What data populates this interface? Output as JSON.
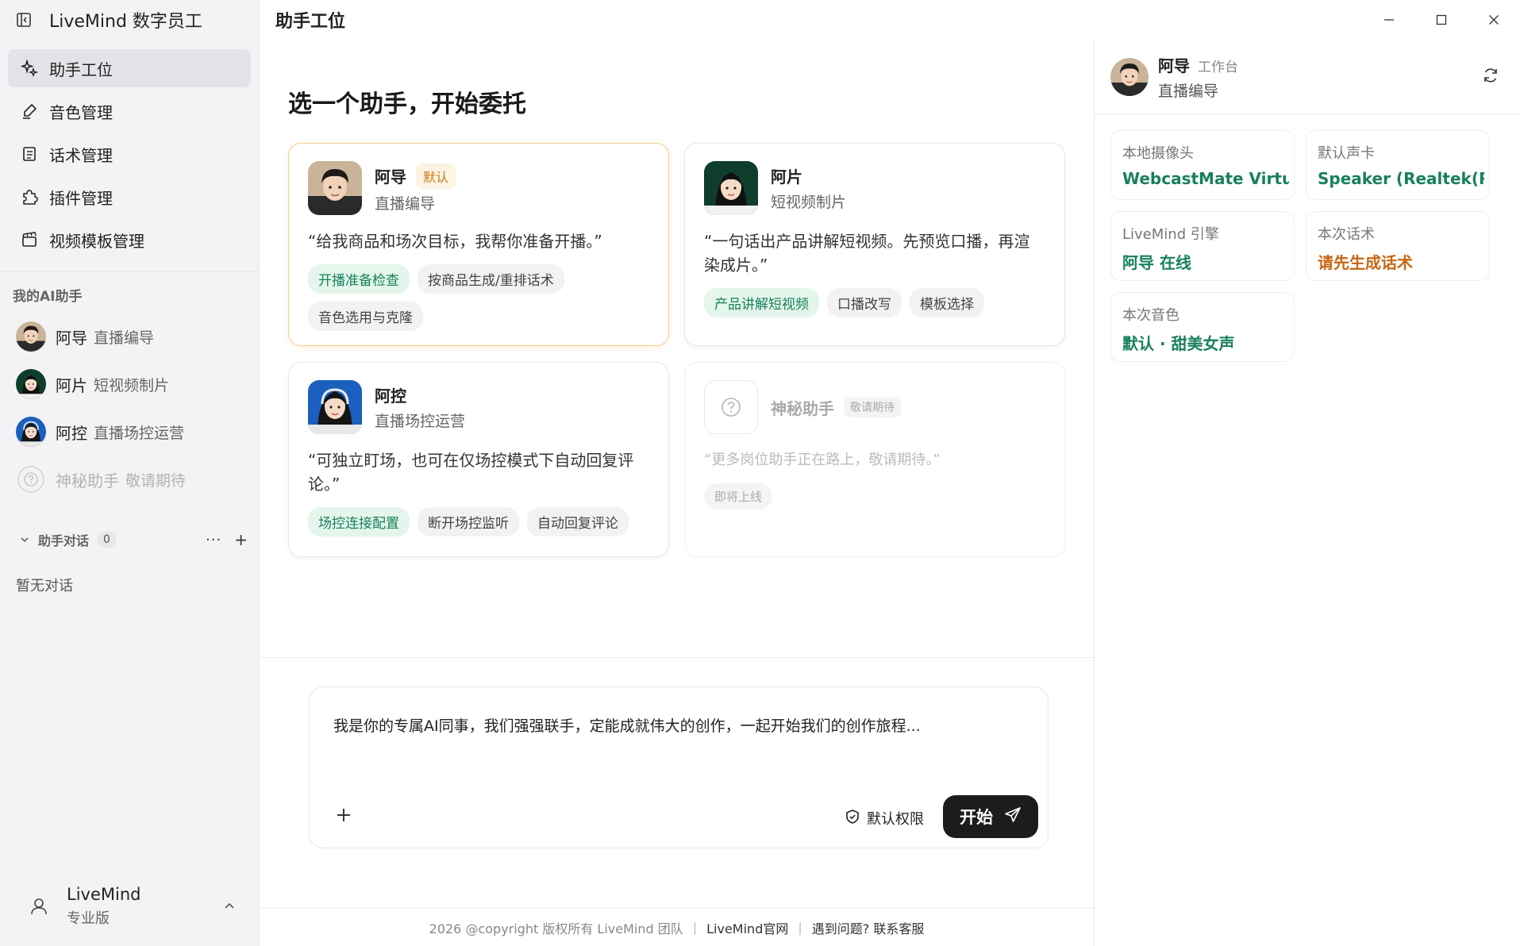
{
  "app": {
    "title": "LiveMind 数字员工"
  },
  "page": {
    "title": "助手工位",
    "heading": "选一个助手，开始委托"
  },
  "nav": [
    {
      "label": "助手工位",
      "icon": "sparkle-icon",
      "active": true
    },
    {
      "label": "音色管理",
      "icon": "brush-icon"
    },
    {
      "label": "话术管理",
      "icon": "script-icon"
    },
    {
      "label": "插件管理",
      "icon": "puzzle-icon"
    },
    {
      "label": "视频模板管理",
      "icon": "clapper-icon"
    }
  ],
  "sidebar": {
    "agents_title": "我的AI助手",
    "agents": [
      {
        "name": "阿导",
        "role": "直播编导"
      },
      {
        "name": "阿片",
        "role": "短视频制片"
      },
      {
        "name": "阿控",
        "role": "直播场控运营"
      },
      {
        "name": "神秘助手",
        "role": "敬请期待"
      }
    ],
    "conv_title": "助手对话",
    "conv_count": "0",
    "conv_more": "···",
    "conv_add": "+",
    "conv_empty": "暂无对话",
    "user_name": "LiveMind",
    "user_plan": "专业版"
  },
  "cards": [
    {
      "name": "阿导",
      "badge": "默认",
      "role": "直播编导",
      "quote": "“给我商品和场次目标，我帮你准备开播。”",
      "tags": [
        "开播准备检查",
        "按商品生成/重排话术",
        "音色选用与克隆"
      ]
    },
    {
      "name": "阿片",
      "role": "短视频制片",
      "quote": "“一句话出产品讲解短视频。先预览口播，再渲染成片。”",
      "tags": [
        "产品讲解短视频",
        "口播改写",
        "模板选择"
      ]
    },
    {
      "name": "阿控",
      "role": "直播场控运营",
      "quote": "“可独立盯场，也可在仅场控模式下自动回复评论。”",
      "tags": [
        "场控连接配置",
        "断开场控监听",
        "自动回复评论"
      ]
    },
    {
      "name": "神秘助手",
      "badge": "敬请期待",
      "quote": "“更多岗位助手正在路上，敬请期待。”",
      "tags": [
        "即将上线"
      ]
    }
  ],
  "composer": {
    "text": "我是你的专属AI同事，我们强强联手，定能成就伟大的创作，一起开始我们的创作旅程...",
    "permission": "默认权限",
    "start": "开始",
    "add": "+"
  },
  "footer": {
    "copyright": "2026 @copyright 版权所有 LiveMind 团队",
    "site": "LiveMind官网",
    "help": "遇到问题? 联系客服",
    "sep": "|"
  },
  "panel": {
    "name": "阿导",
    "sub": "工作台",
    "role": "直播编导",
    "items": [
      {
        "label": "本地摄像头",
        "value": "WebcastMate Virtu..."
      },
      {
        "label": "默认声卡",
        "value": "Speaker (Realtek(R..."
      },
      {
        "label": "LiveMind 引擎",
        "value": "阿导 在线"
      },
      {
        "label": "本次话术",
        "value": "请先生成话术"
      },
      {
        "label": "本次音色",
        "value": "默认 · 甜美女声"
      }
    ]
  },
  "colors": {
    "accent_green": "#18805c",
    "warn_orange": "#c86614",
    "default_badge": "#c77b1a"
  }
}
